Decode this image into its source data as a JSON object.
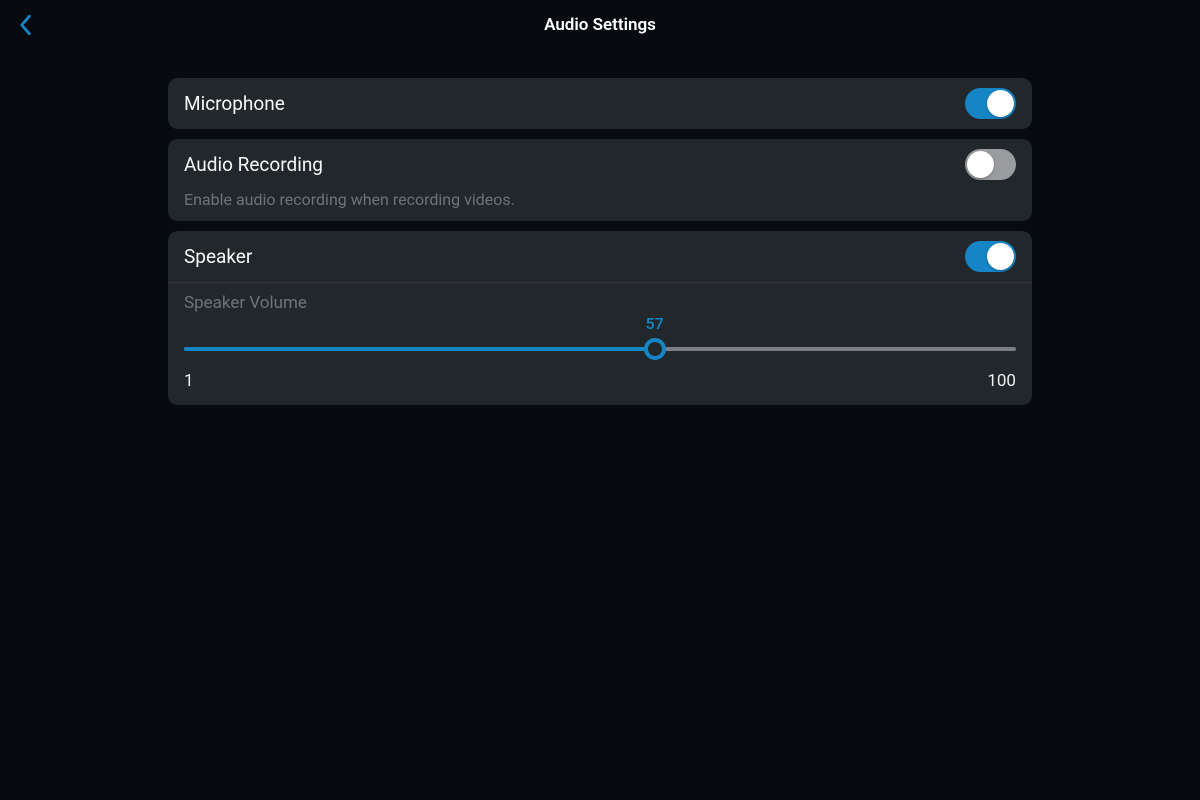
{
  "header": {
    "title": "Audio Settings"
  },
  "microphone": {
    "label": "Microphone",
    "enabled": true
  },
  "audio_recording": {
    "label": "Audio Recording",
    "description": "Enable audio recording when recording videos.",
    "enabled": false
  },
  "speaker": {
    "label": "Speaker",
    "enabled": true,
    "volume_label": "Speaker Volume",
    "volume_value": 57,
    "volume_min": 1,
    "volume_max": 100
  },
  "colors": {
    "accent": "#1585c5",
    "card_bg": "#22272c",
    "bg": "#070a0e"
  }
}
